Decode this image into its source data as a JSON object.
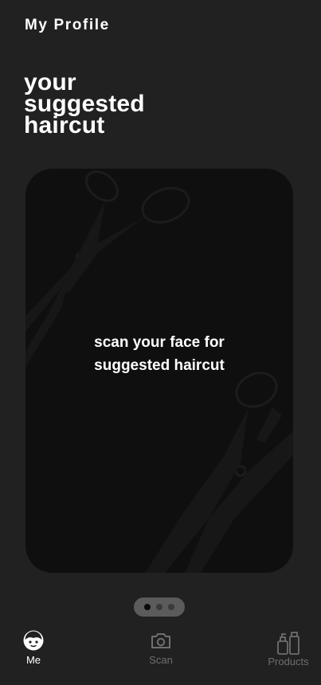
{
  "header": {
    "title": "My Profile"
  },
  "main": {
    "heading_lines": [
      "your",
      "suggested",
      "haircut"
    ],
    "card": {
      "message_lines": [
        "scan your face for",
        "suggested haircut"
      ]
    },
    "pager": {
      "count": 3,
      "active_index": 0
    }
  },
  "bottom_nav": {
    "items": [
      {
        "label": "Me",
        "icon": "face-icon",
        "active": true
      },
      {
        "label": "Scan",
        "icon": "camera-icon",
        "active": false
      },
      {
        "label": "Products",
        "icon": "products-icon",
        "active": false
      }
    ]
  },
  "colors": {
    "background": "#212121",
    "card": "#0f0f0f",
    "text": "#ffffff",
    "inactive": "#6f6f6f"
  }
}
